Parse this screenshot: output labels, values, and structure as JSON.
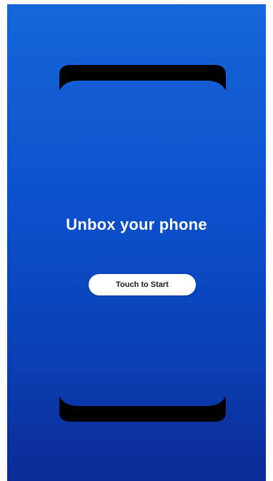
{
  "screen": {
    "headline": "Unbox your phone",
    "start_button_label": "Touch to Start",
    "illustration_icon": "phone-outline-icon"
  },
  "colors": {
    "background_top": "#1666da",
    "background_bottom": "#0c2b95",
    "phone_outline": "#000000",
    "button_bg": "#ffffff",
    "text_light": "#ffffff",
    "text_dark": "#1a1a1a"
  }
}
